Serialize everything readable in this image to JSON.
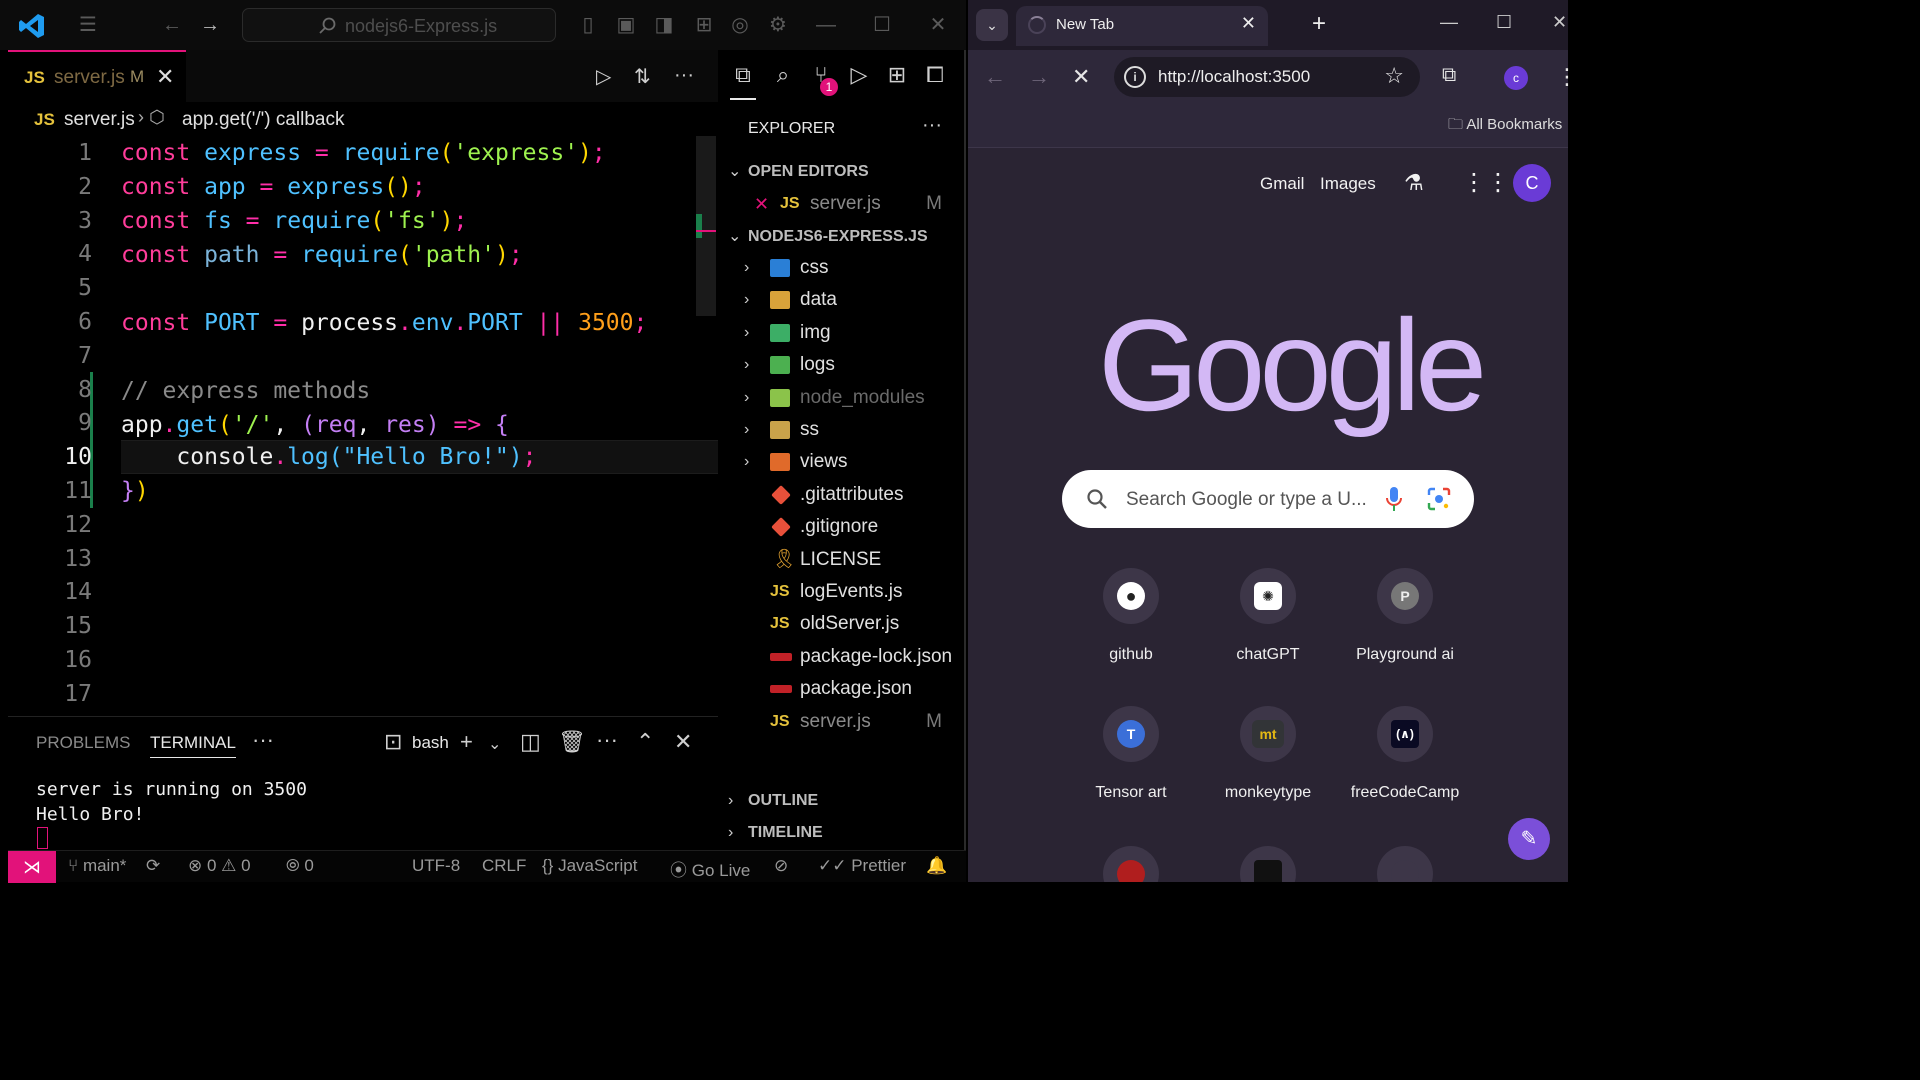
{
  "vscode": {
    "title_search": "nodejs6-Express.js",
    "tab": {
      "lang_badge": "JS",
      "file": "server.js",
      "status": "M",
      "close": "✕"
    },
    "breadcrumb": {
      "lang_badge": "JS",
      "file": "server.js",
      "symbol": "app.get('/') callback"
    },
    "line_numbers": [
      "1",
      "2",
      "3",
      "4",
      "5",
      "6",
      "7",
      "8",
      "9",
      "10",
      "11",
      "12",
      "13",
      "14",
      "15",
      "16",
      "17"
    ],
    "current_line": "10",
    "code": {
      "l1": {
        "kw": "const",
        "name": "express",
        "op": "=",
        "fn": "require",
        "o": "(",
        "str": "'express'",
        "c": ")",
        "semi": ";"
      },
      "l2": {
        "kw": "const",
        "name": "app",
        "op": "=",
        "fn": "express",
        "paren": "()",
        "semi": ";"
      },
      "l3": {
        "kw": "const",
        "name": "fs",
        "op": "=",
        "fn": "require",
        "o": "(",
        "str": "'fs'",
        "c": ")",
        "semi": ";"
      },
      "l4": {
        "kw": "const",
        "name": "path",
        "op": "=",
        "fn": "require",
        "o": "(",
        "str": "'path'",
        "c": ")",
        "semi": ";"
      },
      "l6": {
        "kw": "const",
        "name": "PORT",
        "op": "=",
        "obj": "process",
        "dot1": ".",
        "prop": "env",
        "dot2": ".",
        "prop2": "PORT",
        "or": "||",
        "num": "3500",
        "semi": ";"
      },
      "l8": {
        "comment": "// express methods"
      },
      "l9": {
        "obj": "app",
        "dot": ".",
        "fn": "get",
        "o": "(",
        "str": "'/'",
        "comma": ",",
        "po": "(",
        "a1": "req",
        "comma2": ",",
        "a2": "res",
        "pc": ")",
        "arrow": "=>",
        "brace": "{"
      },
      "l10": {
        "obj": "console",
        "dot": ".",
        "fn": "log",
        "o": "(",
        "str": "\"Hello Bro!\"",
        "c": ")",
        "semi": ";"
      },
      "l11": {
        "brace": "}",
        "paren": ")"
      }
    },
    "panel": {
      "tabs": [
        "PROBLEMS",
        "TERMINAL"
      ],
      "shell": "bash",
      "terminal_lines": [
        "server is running on 3500",
        "Hello Bro!"
      ]
    },
    "sidebar": {
      "title": "EXPLORER",
      "open_editors": "OPEN EDITORS",
      "open_file": {
        "name": "server.js",
        "status": "M"
      },
      "project": "NODEJS6-EXPRESS.JS",
      "items": [
        {
          "name": "css",
          "type": "folder"
        },
        {
          "name": "data",
          "type": "folder"
        },
        {
          "name": "img",
          "type": "folder"
        },
        {
          "name": "logs",
          "type": "folder"
        },
        {
          "name": "node_modules",
          "type": "folder"
        },
        {
          "name": "ss",
          "type": "folder"
        },
        {
          "name": "views",
          "type": "folder"
        },
        {
          "name": ".gitattributes",
          "type": "git"
        },
        {
          "name": ".gitignore",
          "type": "git"
        },
        {
          "name": "LICENSE",
          "type": "license"
        },
        {
          "name": "logEvents.js",
          "type": "js"
        },
        {
          "name": "oldServer.js",
          "type": "js"
        },
        {
          "name": "package-lock.json",
          "type": "npm"
        },
        {
          "name": "package.json",
          "type": "npm"
        },
        {
          "name": "server.js",
          "type": "js",
          "status": "M"
        }
      ],
      "outline": "OUTLINE",
      "timeline": "TIMELINE",
      "scm_badge": "1"
    },
    "status": {
      "branch": "main*",
      "errors": "0",
      "warnings": "0",
      "ports": "0",
      "encoding": "UTF-8",
      "eol": "CRLF",
      "language": "JavaScript",
      "golive": "Go Live",
      "prettier": "Prettier"
    },
    "colors": {
      "accent": "#e2127a",
      "keyword": "#ff3d9a",
      "string": "#9ef24f",
      "number": "#ff9f1a"
    }
  },
  "chrome": {
    "tab_title": "New Tab",
    "url": "http://localhost:3500",
    "bookmarks": "All Bookmarks",
    "profile_initial": "c",
    "google": {
      "links": [
        "Gmail",
        "Images"
      ],
      "avatar": "C",
      "logo": "Google",
      "search_placeholder": "Search Google or type a U...",
      "shortcuts": [
        {
          "label": "github",
          "icon": "github-icon"
        },
        {
          "label": "chatGPT",
          "icon": "openai-icon"
        },
        {
          "label": "Playground ai",
          "glyph": "P"
        },
        {
          "label": "Tensor art",
          "glyph": "T"
        },
        {
          "label": "monkeytype",
          "glyph": "mt"
        },
        {
          "label": "freeCodeCamp",
          "glyph": "(∧)"
        }
      ]
    }
  }
}
